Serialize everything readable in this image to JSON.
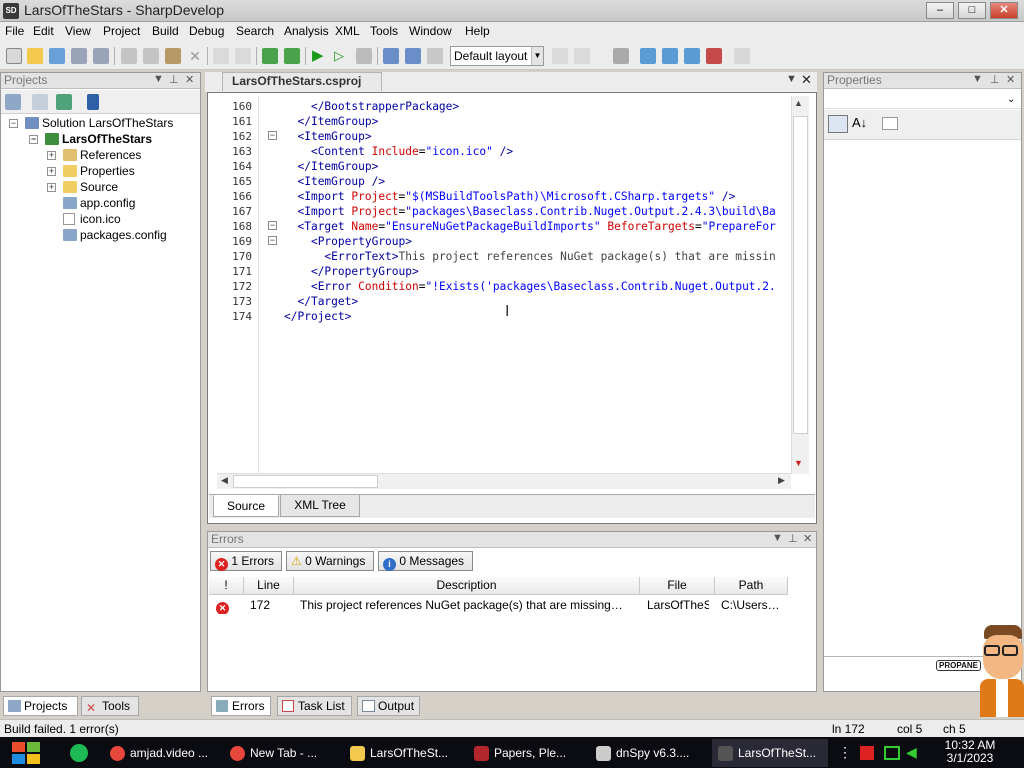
{
  "window": {
    "title": "LarsOfTheStars - SharpDevelop",
    "app_icon": "SD",
    "controls": {
      "minimize": "–",
      "maximize": "□",
      "close": "✕"
    }
  },
  "menu": [
    "File",
    "Edit",
    "View",
    "Project",
    "Build",
    "Debug",
    "Search",
    "Analysis",
    "XML",
    "Tools",
    "Window",
    "Help"
  ],
  "toolbar": {
    "layout": "Default layout"
  },
  "projects": {
    "title": "Projects",
    "tree": {
      "solution": "Solution LarsOfTheStars",
      "project": "LarsOfTheStars",
      "items": [
        "References",
        "Properties",
        "Source",
        "app.config",
        "icon.ico",
        "packages.config"
      ]
    },
    "tabs": {
      "projects": "Projects",
      "tools": "Tools"
    }
  },
  "editor": {
    "tab_title": "LarsOfTheStars.csproj",
    "line_numbers": [
      "160",
      "161",
      "162",
      "163",
      "164",
      "165",
      "166",
      "167",
      "168",
      "169",
      "170",
      "171",
      "172",
      "173",
      "174"
    ],
    "lines": [
      "    </BootstrapperPackage>",
      "  </ItemGroup>",
      "  <ItemGroup>",
      "    <Content Include=\"icon.ico\" />",
      "  </ItemGroup>",
      "  <ItemGroup />",
      "  <Import Project=\"$(MSBuildToolsPath)\\Microsoft.CSharp.targets\" />",
      "  <Import Project=\"packages\\Baseclass.Contrib.Nuget.Output.2.4.3\\build\\Ba",
      "  <Target Name=\"EnsureNuGetPackageBuildImports\" BeforeTargets=\"PrepareFor",
      "    <PropertyGroup>",
      "      <ErrorText>This project references NuGet package(s) that are missin",
      "    </PropertyGroup>",
      "    <Error Condition=\"!Exists('packages\\Baseclass.Contrib.Nuget.Output.2.",
      "  </Target>",
      "</Project>"
    ],
    "bottom_tabs": {
      "source": "Source",
      "xml_tree": "XML Tree"
    }
  },
  "errors": {
    "title": "Errors",
    "filters": {
      "errors": "1 Errors",
      "warnings": "0 Warnings",
      "messages": "0 Messages"
    },
    "columns": [
      "!",
      "Line",
      "Description",
      "File",
      "Path"
    ],
    "rows": [
      {
        "line": "172",
        "description": "This project references NuGet package(s) that are missing…",
        "file": "LarsOfTheS",
        "path": "C:\\Users…"
      }
    ]
  },
  "bottom_pad_tabs": {
    "errors": "Errors",
    "task_list": "Task List",
    "output": "Output"
  },
  "properties": {
    "title": "Properties"
  },
  "statusbar": {
    "message": "Build failed. 1 error(s)",
    "line": "ln 172",
    "col": "col 5",
    "ch": "ch 5"
  },
  "taskbar": {
    "items": [
      "amjad.video ...",
      "New Tab - ...",
      "LarsOfTheSt...",
      "Papers, Ple...",
      "dnSpy v6.3....",
      "LarsOfTheSt..."
    ],
    "time": "10:32 AM",
    "date": "3/1/2023",
    "sticker_text": "PROPANE"
  },
  "colors": {
    "error_red": "#d22222",
    "xml_tag": "#0000a0",
    "xml_attr": "#d00000",
    "xml_value": "#0000ff",
    "taskbar": "#0b0b12"
  }
}
